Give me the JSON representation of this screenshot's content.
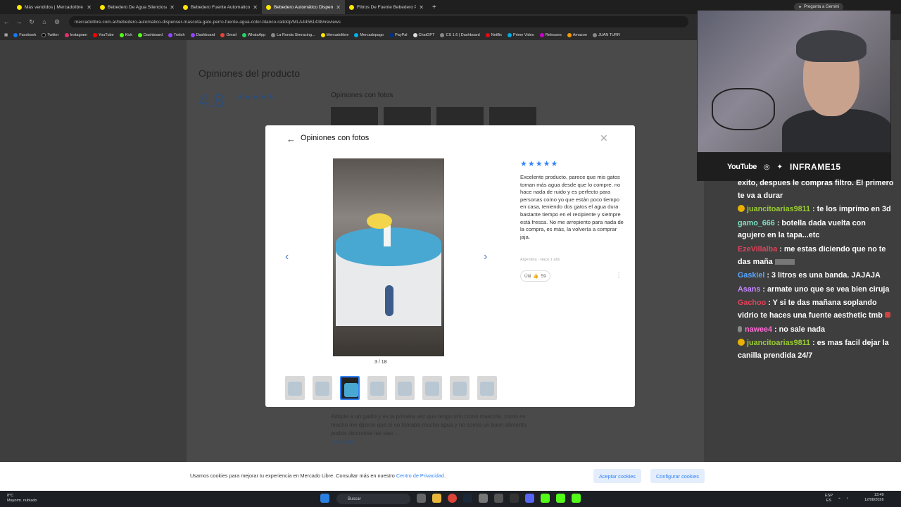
{
  "browser": {
    "tabs": [
      {
        "title": "Más vendidos | Mercadolibre A"
      },
      {
        "title": "Bebedero De Agua Silenciosa G"
      },
      {
        "title": "Bebedero Fuente Automatico A"
      },
      {
        "title": "Bebedero Automático Dispens"
      },
      {
        "title": "Filtros De Fuente Bebedero Pe"
      }
    ],
    "new_tab": "+",
    "gemini_label": "Pregunta a Gemini",
    "url": "mercadolibre.com.ar/bebedero-automatico-dispenser-mascota-gato-perro-fuente-agua-color-blanco-raitot/p/MLA44561438#reviews",
    "bookmarks": [
      "Facebook",
      "Twitter",
      "Instagram",
      "YouTube",
      "Kick",
      "Dashboard",
      "Twitch",
      "Dashboard",
      "Gmail",
      "WhatsApp",
      "La Ronda Simracing...",
      "Mercadolibre",
      "Mercadopago",
      "PayPal",
      "ChatGPT",
      "CS 1.6 | Dashboard",
      "Netflix",
      "Prime Video",
      "Releases",
      "Amazon",
      "JUAN TURR"
    ]
  },
  "page": {
    "title": "Opiniones del producto",
    "rating": "4.8",
    "fotos_heading": "Opiniones con fotos",
    "bg_review_text": "Adopte a un gatito y es la primera vez que tengo uno como mascota, como es macho me dijeron que si no tomaba mucha agua y no comia un buen alimento podria obstruirse las vias ...",
    "bg_more": "Leer más"
  },
  "modal": {
    "title": "Opiniones con fotos",
    "stars": "★★★★★",
    "counter": "3 / 18",
    "review": "Excelente producto, parece que mis gatos toman más agua desde que lo compre, no hace nada de ruido y es perfecto para personas como yo que están poco tiempo en casa, teniendo dos gatos el agua dura bastante tiempo en el recipiente y siempre está fresca. No me arrepiento para nada de la compra, es más, la volvería a comprar jaja.",
    "meta": "Argentina · Hace 1 año",
    "useful_label": "Útil",
    "useful_count": "59"
  },
  "cookie": {
    "text": "Usamos cookies para mejorar tu experiencia en Mercado Libre. Consultar más en nuestro",
    "link": "Centro de Privacidad.",
    "accept": "Aceptar cookies",
    "configure": "Configurar cookies"
  },
  "taskbar": {
    "temp": "8°C",
    "weather": "Mayorm. nublado",
    "search": "Buscar",
    "lang1": "ESP",
    "lang2": "ES",
    "time": "13:49",
    "date": "12/08/2026"
  },
  "stream": {
    "platform": "YouTube",
    "handle": "INFRAME15",
    "chat": [
      {
        "user": "",
        "color": "#ffffff",
        "text": "exito, despues le compras filtro. El primero te va a durar",
        "badge": false
      },
      {
        "user": "juancitoarias9811",
        "color": "#9acd32",
        "text": " : te los imprimo en 3d",
        "badge": true
      },
      {
        "user": "gamo_666",
        "color": "#7fe0c4",
        "text": " : botella dada vuelta con agujero en la tapa...etc",
        "badge": false
      },
      {
        "user": "EzeVillalba",
        "color": "#e0425a",
        "text": " : me estas diciendo que no te das maña",
        "badge": false
      },
      {
        "user": "Gaskiel",
        "color": "#5aa7ff",
        "text": " : 3 litros es una banda. JAJAJA",
        "badge": false
      },
      {
        "user": "Asans",
        "color": "#c788ff",
        "text": " : armate uno que se vea bien ciruja",
        "badge": false
      },
      {
        "user": "Gachoo",
        "color": "#e0425a",
        "text": " : Y si te das mañana soplando vidrio te haces una fuente aesthetic tmb",
        "badge": false
      },
      {
        "user": "nawee4",
        "color": "#ff6ad5",
        "text": " : no sale nada",
        "badge": false
      },
      {
        "user": "juancitoarias9811",
        "color": "#9acd32",
        "text": " : es mas facil dejar la canilla prendida 24/7",
        "badge": true
      }
    ]
  },
  "colors": {
    "accent": "#3483fa",
    "stars": "#3483fa",
    "ml_yellow": "#ffe600"
  }
}
